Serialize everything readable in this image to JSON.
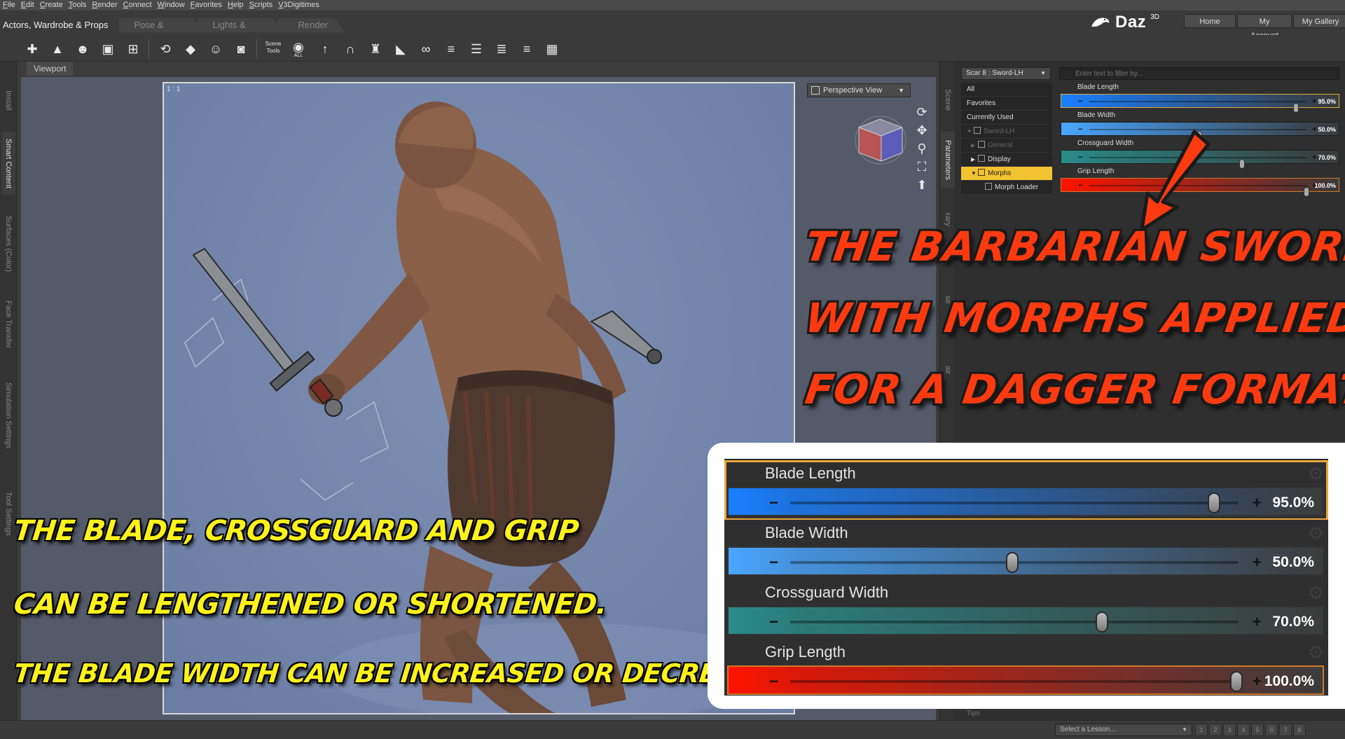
{
  "menubar": [
    "File",
    "Edit",
    "Create",
    "Tools",
    "Render",
    "Connect",
    "Window",
    "Favorites",
    "Help",
    "Scripts",
    "V3Digitimes"
  ],
  "room_tabs": [
    "Actors, Wardrobe & Props",
    "Pose & Animate",
    "Lights & Cameras",
    "Render"
  ],
  "brand": {
    "name": "Daz",
    "sup": "3D"
  },
  "site_buttons": [
    "Home",
    "My Account",
    "My Gallery"
  ],
  "toolbar_icons": [
    "smart-content-icon",
    "environment-icon",
    "figure-icon",
    "props-icon",
    "scene-icon",
    "pose-icon",
    "animation-icon",
    "character-icon",
    "camera-icon",
    "scene-tools-icon",
    "eye-icon",
    "rigging-icon",
    "magnet-icon",
    "shirt-icon",
    "shoe-icon",
    "glasses-icon",
    "align-left-icon",
    "align-center-icon",
    "align-right-icon",
    "align-sub-icon",
    "grid-icon"
  ],
  "scene_tools_label": "Scene Tools",
  "eye_sub": "ALL",
  "left_tabs": [
    "Install",
    "Smart Content",
    "Surfaces (Color)",
    "Face Transfer",
    "Simulation Settings",
    "Tool Settings"
  ],
  "viewport": {
    "tab": "Viewport",
    "ratio": "1 : 1",
    "camera": "Perspective View"
  },
  "right_tabs": [
    "Scene",
    "Parameters",
    "rary",
    "se",
    "air"
  ],
  "parameters": {
    "node": "Scar 8 : Sword-LH",
    "filter_placeholder": "Enter text to filter by...",
    "tree": [
      "All",
      "Favorites",
      "Currently Used",
      "Sword-LH",
      "General",
      "Display",
      "Morphs",
      "Morph Loader"
    ],
    "sliders": [
      {
        "label": "Blade Length",
        "value": "95.0%",
        "level": 0.95,
        "color": "#1a7fff",
        "state": "selected"
      },
      {
        "label": "Blade Width",
        "value": "50.0%",
        "level": 0.5,
        "color": "#4aa6ff",
        "state": "normal"
      },
      {
        "label": "Crossguard Width",
        "value": "70.0%",
        "level": 0.7,
        "color": "#2a8c8a",
        "state": "normal"
      },
      {
        "label": "Grip Length",
        "value": "100.0%",
        "level": 1.0,
        "color": "#ff1400",
        "state": "red"
      }
    ]
  },
  "lesson": {
    "placeholder": "Select a Lesson...",
    "tips": "Tips",
    "steps": [
      "1",
      "2",
      "3",
      "4",
      "5",
      "6",
      "7",
      "8"
    ]
  },
  "headline": [
    "THE BARBARIAN SWORD",
    "WITH MORPHS APPLIED",
    "FOR A DAGGER FORMAT:"
  ],
  "notes": [
    "THE BLADE, CROSSGUARD AND GRIP",
    "CAN BE LENGTHENED OR SHORTENED.",
    "THE BLADE WIDTH CAN BE INCREASED OR DECREASED."
  ],
  "colors": {
    "headline": "#ff3a10",
    "note": "#fff21a",
    "accent": "#f2c230"
  }
}
